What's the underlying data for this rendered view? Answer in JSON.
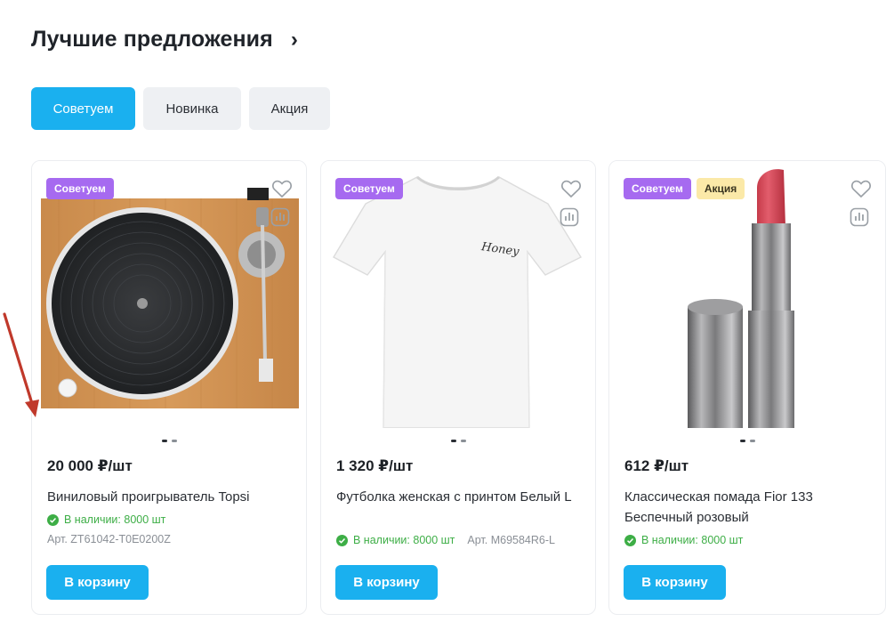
{
  "section": {
    "title": "Лучшие предложения",
    "arrow_glyph": "›"
  },
  "tabs": [
    {
      "label": "Советуем",
      "active": true
    },
    {
      "label": "Новинка",
      "active": false
    },
    {
      "label": "Акция",
      "active": false
    }
  ],
  "colors": {
    "accent": "#1ab0ef",
    "badge_recommended": "#a66af0",
    "badge_sale": "#fbe9a8",
    "in_stock": "#3dae46",
    "annotation_arrow": "#c0392b"
  },
  "products": [
    {
      "badges": [
        "Советуем"
      ],
      "image_icon": "turntable-image",
      "price": "20 000 ₽/шт",
      "name": "Виниловый проигрыватель Topsi",
      "stock": "В наличии: 8000 шт",
      "article": "Арт.  ZT61042-T0E0200Z",
      "cart_label": "В корзину"
    },
    {
      "badges": [
        "Советуем"
      ],
      "image_icon": "tshirt-image",
      "image_text": "Honey",
      "price": "1 320 ₽/шт",
      "name": "Футболка женская с принтом Белый L",
      "stock": "В наличии: 8000 шт",
      "article": "Арт. M69584R6-L",
      "cart_label": "В корзину"
    },
    {
      "badges": [
        "Советуем",
        "Акция"
      ],
      "image_icon": "lipstick-image",
      "price": "612 ₽/шт",
      "name": "Классическая помада Fior 133 Беспечный розовый",
      "stock": "В наличии: 8000 шт",
      "cart_label": "В корзину"
    }
  ]
}
